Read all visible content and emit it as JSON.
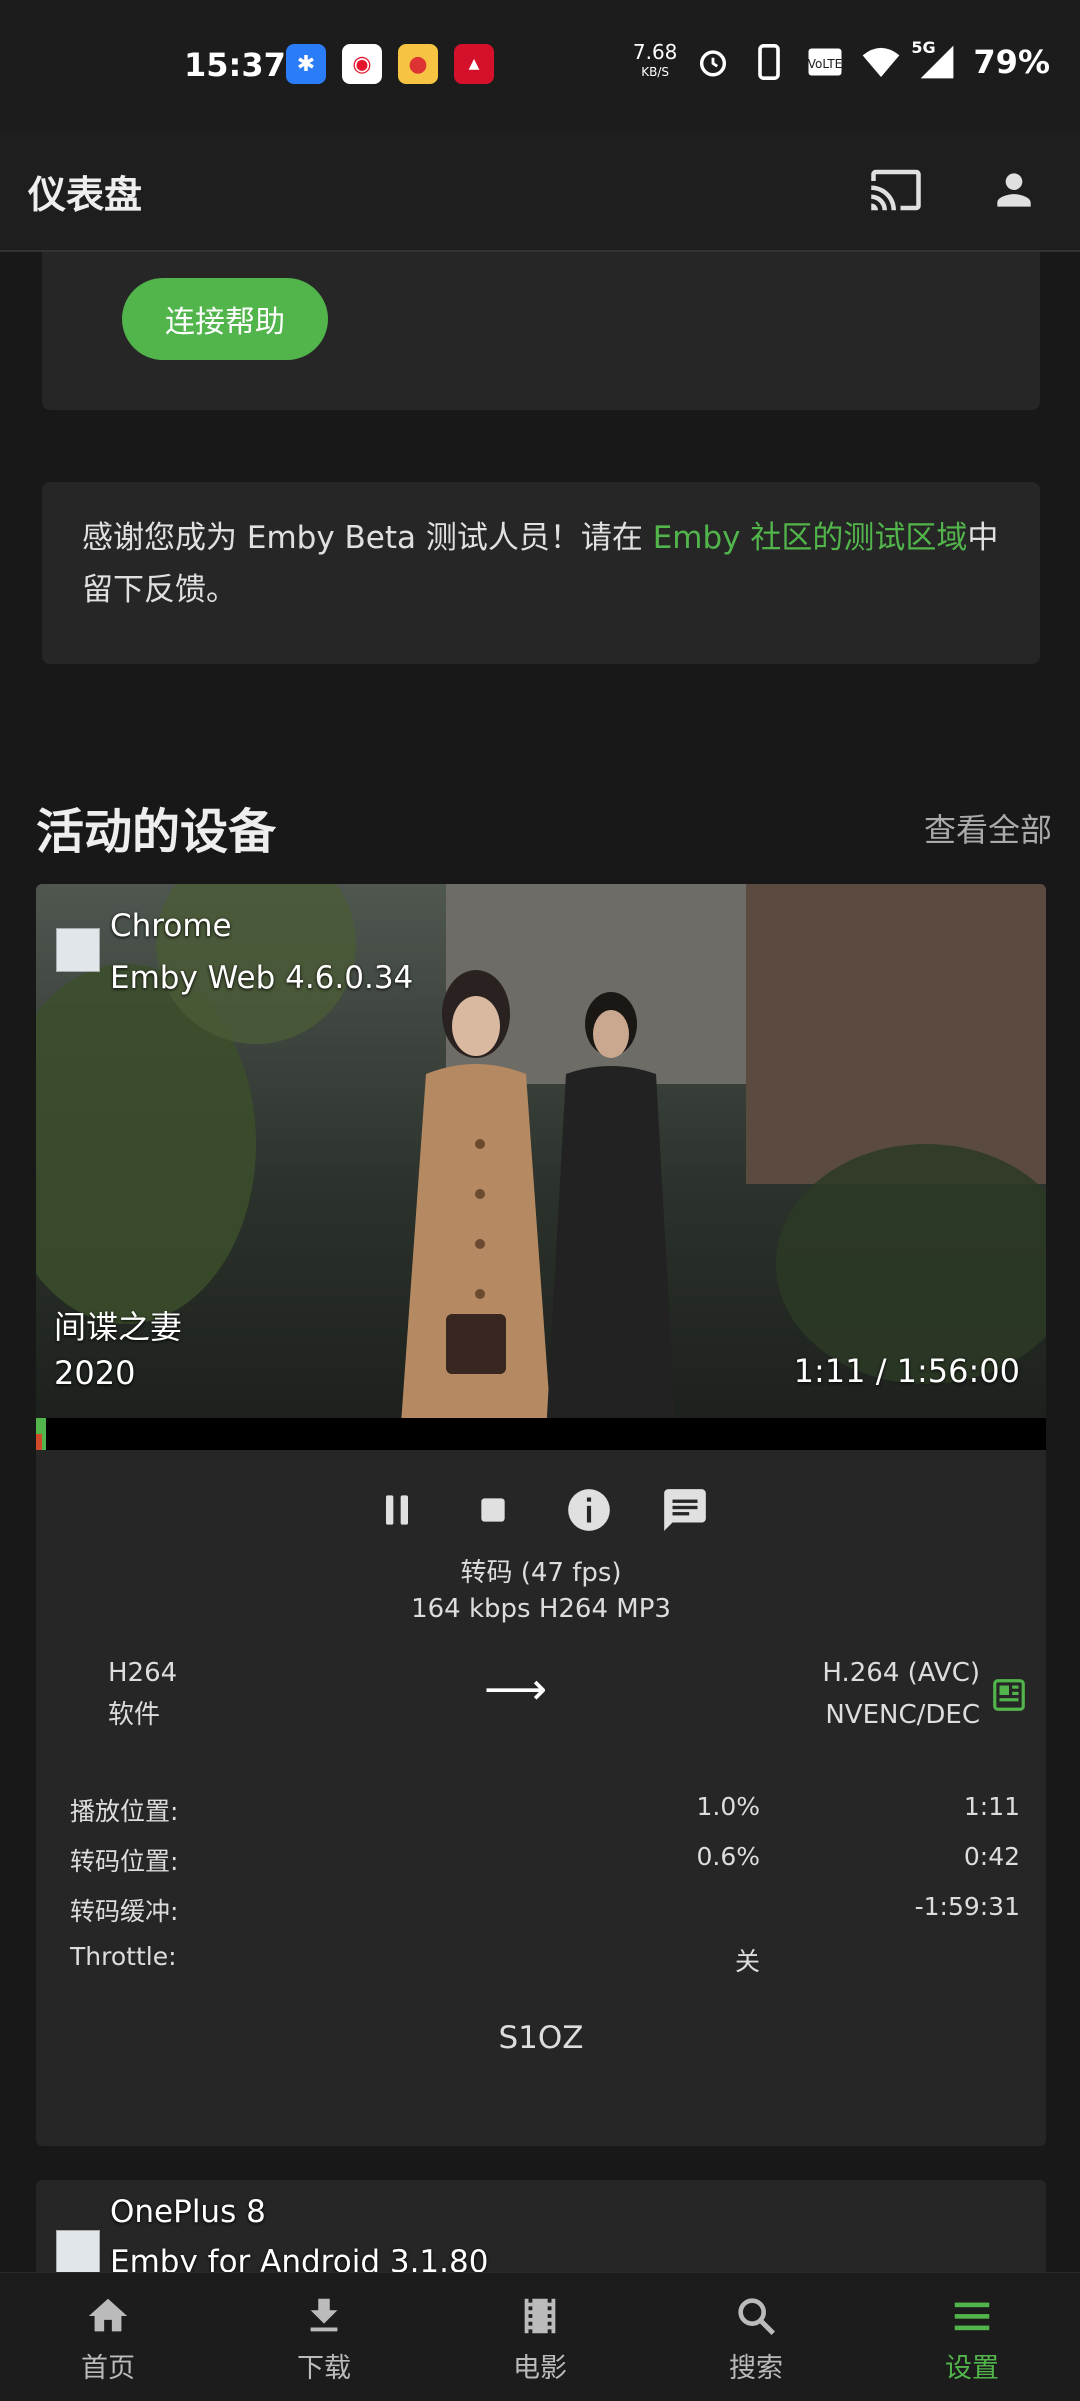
{
  "status_bar": {
    "time": "15:37",
    "net_speed": "7.68",
    "net_unit": "KB/S",
    "battery": "79%",
    "network_type": "5G",
    "volte": "VoLTE",
    "app_icons": [
      "dingtalk-icon",
      "weibo-icon",
      "pig-app-icon",
      "tmall-icon"
    ]
  },
  "app_bar": {
    "title": "仪表盘",
    "cast_icon": "cast-icon",
    "user_icon": "user-icon"
  },
  "help_card": {
    "button_label": "连接帮助"
  },
  "beta_notice": {
    "text_before": "感谢您成为 Emby Beta 测试人员！请在 ",
    "link_text": "Emby 社区的测试区域",
    "text_after": "中留下反馈。"
  },
  "active_devices": {
    "title": "活动的设备",
    "see_all": "查看全部",
    "devices": [
      {
        "name": "Chrome",
        "app": "Emby Web 4.6.0.34",
        "movie_title": "间谍之妻",
        "movie_year": "2020",
        "time_display": "1:11 / 1:56:00",
        "played_fraction": 0.01,
        "transcoded_fraction": 0.006,
        "controls": [
          "pause-icon",
          "stop-icon",
          "info-icon",
          "message-icon"
        ],
        "transcode_line1": "转码 (47 fps)",
        "transcode_line2": "164 kbps H264 MP3",
        "source_codec": "H264",
        "source_mode": "软件",
        "target_codec": "H.264 (AVC)",
        "target_mode": "NVENC/DEC",
        "stats": [
          {
            "label": "播放位置:",
            "pct": "1.0%",
            "value": "1:11"
          },
          {
            "label": "转码位置:",
            "pct": "0.6%",
            "value": "0:42"
          },
          {
            "label": "转码缓冲:",
            "pct": "",
            "value": "-1:59:31"
          },
          {
            "label": "Throttle:",
            "pct": "关",
            "value": ""
          }
        ],
        "session_id": "S1OZ"
      },
      {
        "name": "OnePlus 8",
        "app": "Emby for Android 3.1.80"
      }
    ]
  },
  "bottom_nav": [
    {
      "label": "首页",
      "icon": "home-icon",
      "active": false
    },
    {
      "label": "下载",
      "icon": "download-icon",
      "active": false
    },
    {
      "label": "电影",
      "icon": "film-icon",
      "active": false
    },
    {
      "label": "搜索",
      "icon": "search-icon",
      "active": false
    },
    {
      "label": "设置",
      "icon": "menu-icon",
      "active": true
    }
  ],
  "colors": {
    "accent": "#52b54b",
    "background": "#181818",
    "card": "#262626"
  }
}
